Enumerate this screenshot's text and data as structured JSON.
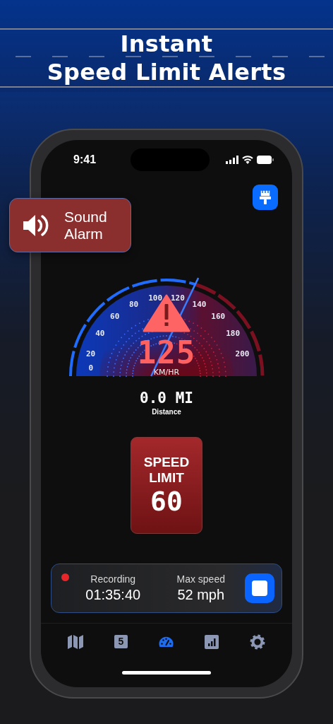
{
  "headline": [
    "Instant",
    "Speed Limit Alerts"
  ],
  "callout": {
    "kind": "sound",
    "lines": [
      "Sound",
      "Alarm"
    ]
  },
  "status_bar": {
    "time": "9:41"
  },
  "theme_button": {
    "kind": "brush"
  },
  "gauge": {
    "speed": "125",
    "unit": "KM/HR",
    "warning": true,
    "dial_labels": [
      "0",
      "20",
      "40",
      "60",
      "80",
      "100",
      "120",
      "140",
      "160",
      "180",
      "200"
    ]
  },
  "distance": {
    "value": "0.0 MI",
    "label": "Distance"
  },
  "speed_limit": {
    "lines": [
      "SPEED",
      "LIMIT"
    ],
    "value": "60"
  },
  "recording_card": {
    "recording": true,
    "stats": [
      {
        "label": "Recording",
        "value": "01:35:40"
      },
      {
        "label": "Max speed",
        "value": "52 mph"
      }
    ]
  },
  "tabs": [
    {
      "kind": "map",
      "selected": false
    },
    {
      "kind": "sign",
      "badge": "5",
      "selected": false
    },
    {
      "kind": "gauge",
      "selected": true
    },
    {
      "kind": "chart",
      "selected": false
    },
    {
      "kind": "gear",
      "selected": false
    }
  ]
}
